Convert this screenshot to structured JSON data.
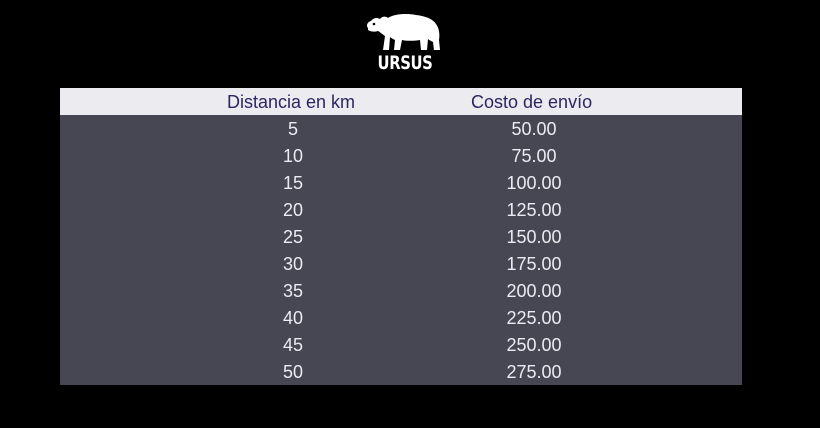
{
  "brand": {
    "name": "URSUS",
    "logo_icon": "bear-icon"
  },
  "table": {
    "headers": [
      "Distancia en km",
      "Costo de envío"
    ],
    "rows": [
      {
        "distance": "5",
        "cost": "50.00"
      },
      {
        "distance": "10",
        "cost": "75.00"
      },
      {
        "distance": "15",
        "cost": "100.00"
      },
      {
        "distance": "20",
        "cost": "125.00"
      },
      {
        "distance": "25",
        "cost": "150.00"
      },
      {
        "distance": "30",
        "cost": "175.00"
      },
      {
        "distance": "35",
        "cost": "200.00"
      },
      {
        "distance": "40",
        "cost": "225.00"
      },
      {
        "distance": "45",
        "cost": "250.00"
      },
      {
        "distance": "50",
        "cost": "275.00"
      }
    ]
  },
  "colors": {
    "background": "#000000",
    "header_bg": "#ebebf0",
    "header_text": "#2d2660",
    "body_bg": "#464753",
    "body_text": "#eceaf2"
  }
}
